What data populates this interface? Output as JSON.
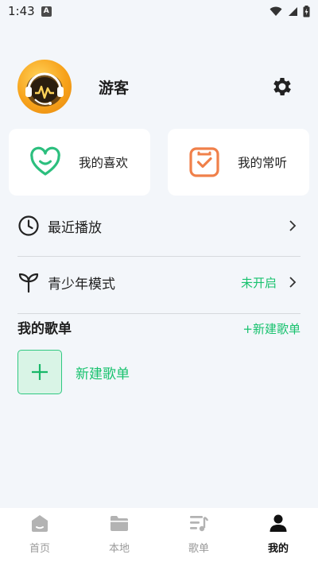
{
  "status_bar": {
    "time": "1:43",
    "notification_letter": "A"
  },
  "profile": {
    "username": "游客"
  },
  "cards": [
    {
      "label": "我的喜欢",
      "icon": "heart-smile-icon",
      "color": "#2cbf7e"
    },
    {
      "label": "我的常听",
      "icon": "check-square-icon",
      "color": "#f0804a"
    }
  ],
  "rows": {
    "recent": {
      "label": "最近播放"
    },
    "teen": {
      "label": "青少年模式",
      "status": "未开启"
    }
  },
  "playlists": {
    "title": "我的歌单",
    "new_link": "+新建歌单",
    "new_item_label": "新建歌单"
  },
  "bottom_nav": [
    {
      "label": "首页",
      "icon": "home-icon",
      "active": false
    },
    {
      "label": "本地",
      "icon": "folder-icon",
      "active": false
    },
    {
      "label": "歌单",
      "icon": "playlist-icon",
      "active": false
    },
    {
      "label": "我的",
      "icon": "user-icon",
      "active": true
    }
  ],
  "colors": {
    "accent": "#18c26e",
    "orange": "#f0804a",
    "background": "#f3f6fa"
  }
}
